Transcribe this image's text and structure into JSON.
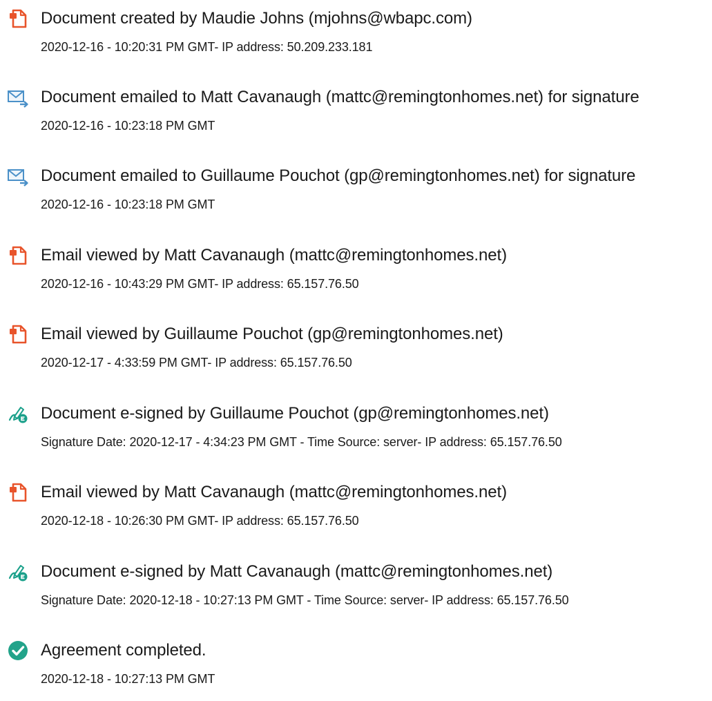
{
  "colors": {
    "doc_orange": "#e8542b",
    "mail_blue": "#4a90c8",
    "sign_teal": "#1aa08a",
    "check_teal": "#22a38a"
  },
  "events": [
    {
      "icon": "document-icon",
      "title": "Document created by Maudie Johns (mjohns@wbapc.com)",
      "detail": "2020-12-16 - 10:20:31 PM GMT- IP address: 50.209.233.181"
    },
    {
      "icon": "email-icon",
      "title": "Document emailed to Matt Cavanaugh (mattc@remingtonhomes.net) for signature",
      "detail": "2020-12-16 - 10:23:18 PM GMT"
    },
    {
      "icon": "email-icon",
      "title": "Document emailed to Guillaume Pouchot (gp@remingtonhomes.net) for signature",
      "detail": "2020-12-16 - 10:23:18 PM GMT"
    },
    {
      "icon": "document-icon",
      "title": "Email viewed by Matt Cavanaugh (mattc@remingtonhomes.net)",
      "detail": "2020-12-16 - 10:43:29 PM GMT- IP address: 65.157.76.50"
    },
    {
      "icon": "document-icon",
      "title": "Email viewed by Guillaume Pouchot (gp@remingtonhomes.net)",
      "detail": "2020-12-17 - 4:33:59 PM GMT- IP address: 65.157.76.50"
    },
    {
      "icon": "esign-icon",
      "title": "Document e-signed by Guillaume Pouchot (gp@remingtonhomes.net)",
      "detail": "Signature Date: 2020-12-17 - 4:34:23 PM GMT - Time Source: server- IP address: 65.157.76.50"
    },
    {
      "icon": "document-icon",
      "title": "Email viewed by Matt Cavanaugh (mattc@remingtonhomes.net)",
      "detail": "2020-12-18 - 10:26:30 PM GMT- IP address: 65.157.76.50"
    },
    {
      "icon": "esign-icon",
      "title": "Document e-signed by Matt Cavanaugh (mattc@remingtonhomes.net)",
      "detail": "Signature Date: 2020-12-18 - 10:27:13 PM GMT - Time Source: server- IP address: 65.157.76.50"
    },
    {
      "icon": "check-circle-icon",
      "title": "Agreement completed.",
      "detail": "2020-12-18 - 10:27:13 PM GMT"
    }
  ]
}
